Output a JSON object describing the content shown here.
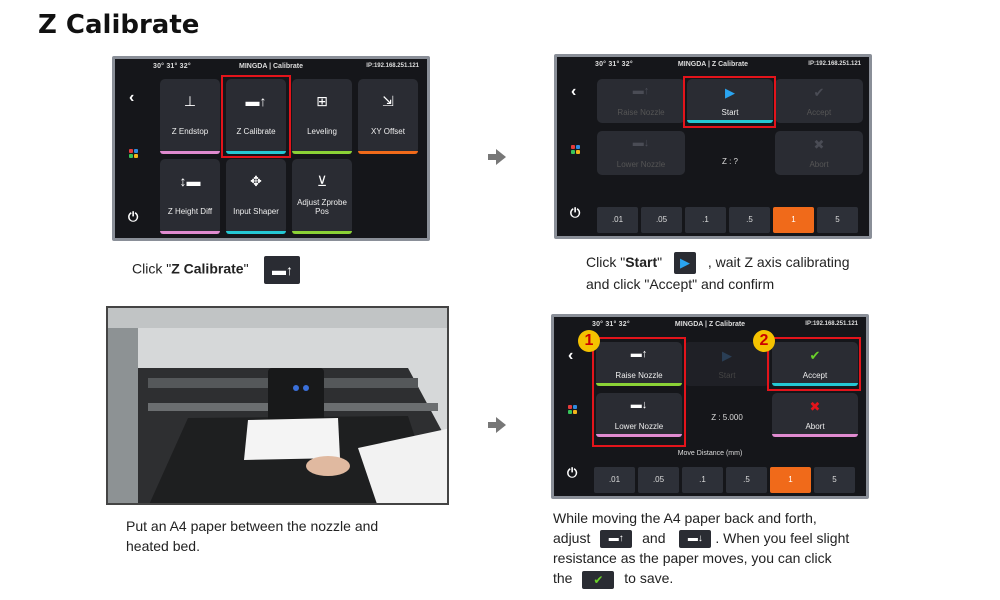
{
  "page": {
    "title": "Z Calibrate"
  },
  "screen1": {
    "temps": "30° 31° 32°",
    "header": "MINGDA | Calibrate",
    "ip": "IP:192.168.251.121",
    "tiles": [
      {
        "label": "Z Endstop",
        "bar": "#e08bd0"
      },
      {
        "label": "Z Calibrate",
        "bar": "#24c8d4"
      },
      {
        "label": "Leveling",
        "bar": "#8bd236"
      },
      {
        "label": "XY Offset",
        "bar": "#f06a1a"
      },
      {
        "label": "Z Height Diff",
        "bar": "#e08bd0"
      },
      {
        "label": "Input Shaper",
        "bar": "#24c8d4"
      },
      {
        "label": "Adjust Zprobe Pos",
        "bar": "#8bd236"
      }
    ]
  },
  "screen2": {
    "temps": "30° 31° 32°",
    "header": "MINGDA | Z Calibrate",
    "ip": "IP:192.168.251.121",
    "raise": "Raise Nozzle",
    "lower": "Lower Nozzle",
    "start": "Start",
    "accept": "Accept",
    "abort": "Abort",
    "z": "Z : ?",
    "distances": [
      ".01",
      ".05",
      ".1",
      ".5",
      "1",
      "5"
    ],
    "selected_index": 4
  },
  "screen3": {
    "temps": "30° 31° 32°",
    "header": "MINGDA | Z Calibrate",
    "ip": "IP:192.168.251.121",
    "raise": "Raise Nozzle",
    "lower": "Lower Nozzle",
    "start": "Start",
    "accept": "Accept",
    "abort": "Abort",
    "z": "Z : 5.000",
    "move_label": "Move Distance (mm)",
    "distances": [
      ".01",
      ".05",
      ".1",
      ".5",
      "1",
      "5"
    ],
    "selected_index": 4,
    "badge1": "1",
    "badge2": "2"
  },
  "captions": {
    "c1_pre": "Click \"",
    "c1_bold": "Z Calibrate",
    "c1_post": "\"",
    "c2_pre": "Click \"",
    "c2_bold": "Start",
    "c2_post": "\"",
    "c2_rest": ", wait Z axis calibrating",
    "c2_line2": "and click \"Accept\" and confirm",
    "c3_line1": "Put an A4 paper between the nozzle and",
    "c3_line2": "heated bed.",
    "c4_line1": "While moving the A4 paper back and forth,",
    "c4_adjust": "adjust",
    "c4_and": "and",
    "c4_after": ". When you feel slight",
    "c4_line3": "resistance as the paper moves, you can click",
    "c4_the": "the",
    "c4_end": "to save."
  }
}
